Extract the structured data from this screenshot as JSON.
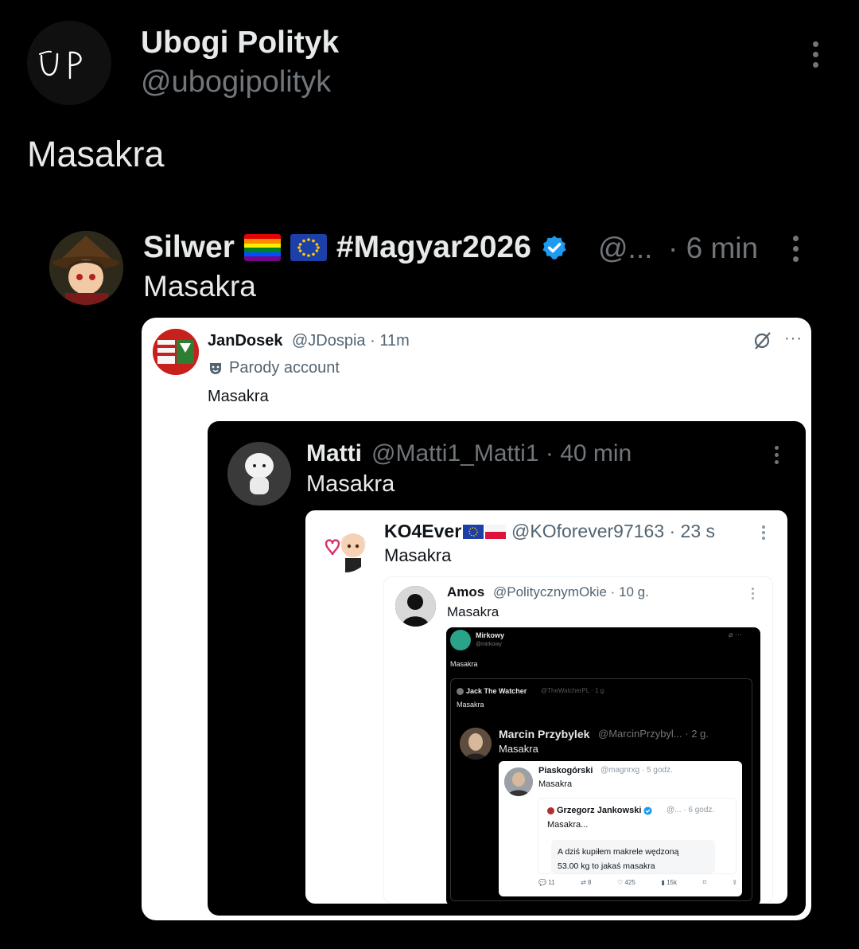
{
  "post": {
    "author_logo": "UP",
    "author_name": "Ubogi Polityk",
    "author_handle": "@ubogipolityk",
    "text": "Masakra"
  },
  "quote1": {
    "name": "Silwer",
    "hashtag": "#Magyar2026",
    "handle": "@...",
    "time": "· 6 min",
    "text": "Masakra",
    "flags": [
      "rainbow-flag-icon",
      "eu-flag-icon"
    ],
    "verified_color": "#1d9bf0"
  },
  "quote2": {
    "name": "JanDosek",
    "handle": "@JDospia · 11m",
    "parody": "Parody account",
    "text": "Masakra",
    "more": "···"
  },
  "quote3": {
    "name": "Matti",
    "handle": "@Matti1_Matti1 · 40 min",
    "text": "Masakra"
  },
  "quote4": {
    "name": "KO4Ever",
    "handle": "@KOforever97163 · 23 s",
    "text": "Masakra"
  },
  "quote5": {
    "name": "Amos",
    "handle": "@PolitycznymOkie · 10 g.",
    "text": "Masakra"
  },
  "quote6": {
    "name": "Mirkowy",
    "handle": "@mirkowy",
    "text": "Masakra",
    "icons": "⌀ ···"
  },
  "quote7": {
    "name": "Jack The Watcher",
    "handle": "@TheWatcherPL · 1 g.",
    "text": "Masakra"
  },
  "quote8": {
    "name": "Marcin Przybylek",
    "handle": "@MarcinPrzybyl... · 2 g.",
    "text": "Masakra"
  },
  "quote9": {
    "name": "Piaskogórski",
    "handle": "@magnrxg · 5 godz.",
    "text": "Masakra"
  },
  "quote10": {
    "name": "Grzegorz Jankowski",
    "handle": "@... · 6 godz.",
    "text": "Masakra...",
    "inner_line1": "A dziś kupiłem makrele wędzoną",
    "inner_line2": "53.00 kg to jakaś masakra"
  },
  "actions": {
    "replies": "11",
    "reposts": "8",
    "likes": "425",
    "views": "15k"
  },
  "colors": {
    "background": "#000000",
    "text_primary": "#e7e9ea",
    "text_secondary": "#71767b",
    "verified": "#1d9bf0"
  }
}
